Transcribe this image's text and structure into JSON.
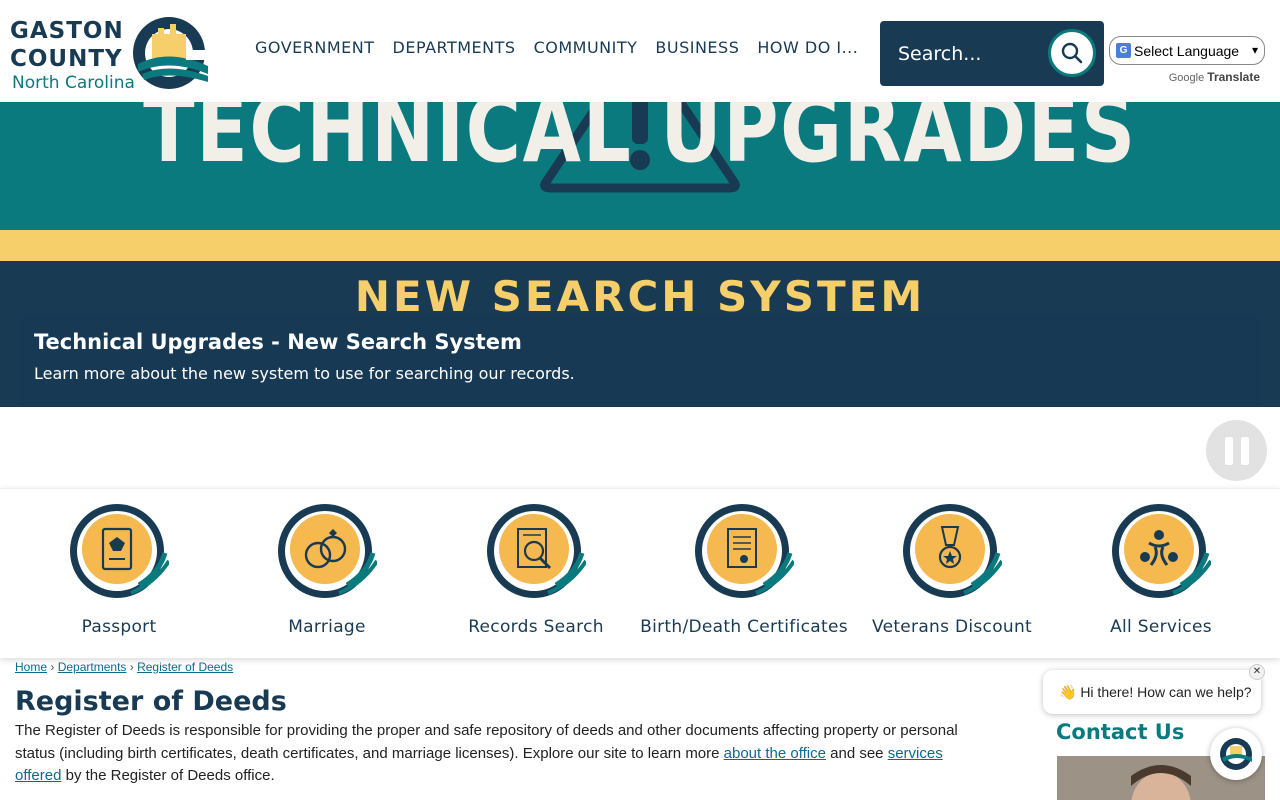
{
  "logo": {
    "line1": "GASTON",
    "line2": "COUNTY",
    "line3": "North Carolina"
  },
  "nav": [
    "GOVERNMENT",
    "DEPARTMENTS",
    "COMMUNITY",
    "BUSINESS",
    "HOW DO I..."
  ],
  "search": {
    "placeholder": "Search..."
  },
  "translate": {
    "select_label": "Select Language",
    "powered_prefix": "Google",
    "powered_suffix": "Translate"
  },
  "banner": {
    "headline": "TECHNICAL UPGRADES",
    "subhead": "NEW SEARCH SYSTEM",
    "caption_title": "Technical Upgrades - New Search System",
    "caption_text": "Learn more about the new system to use for searching our records."
  },
  "services": [
    {
      "label": "Passport",
      "icon": "passport-icon"
    },
    {
      "label": "Marriage",
      "icon": "rings-icon"
    },
    {
      "label": "Records Search",
      "icon": "records-search-icon"
    },
    {
      "label": "Birth/Death Certificates",
      "icon": "certificate-icon"
    },
    {
      "label": "Veterans Discount",
      "icon": "medal-icon"
    },
    {
      "label": "All Services",
      "icon": "people-circle-icon"
    }
  ],
  "breadcrumb": [
    "Home",
    "Departments",
    "Register of Deeds"
  ],
  "page": {
    "title": "Register of Deeds",
    "intro_part1": "The Register of Deeds is responsible for providing the proper and safe repository of deeds and other documents affecting property or personal status (including birth certificates, death certificates, and marriage licenses). Explore our site to learn more ",
    "intro_link1": "about the office",
    "intro_part2": " and see ",
    "intro_link2": "services offered",
    "intro_part3": " by the Register of Deeds office."
  },
  "chat": {
    "greeting": "👋 Hi there! How can we help?",
    "close": "✕"
  },
  "sidebar": {
    "contact_title": "Contact Us"
  },
  "colors": {
    "navy": "#183a53",
    "teal": "#0b7a7e",
    "yellow": "#f6cf6a"
  }
}
